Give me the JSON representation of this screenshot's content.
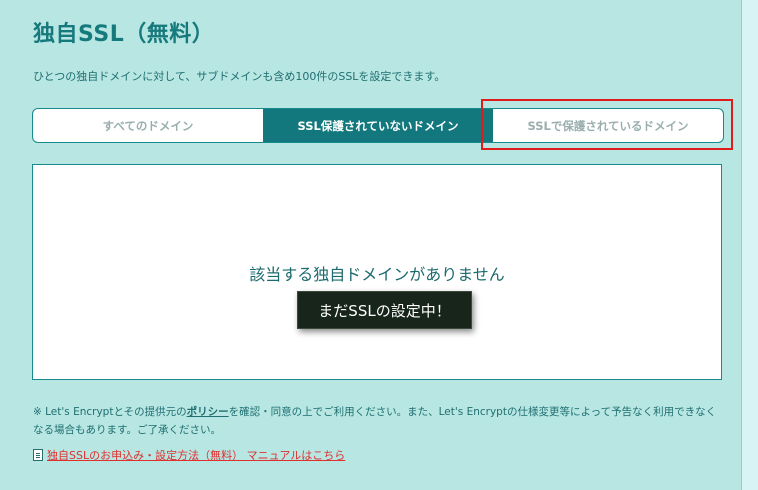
{
  "page": {
    "title": "独自SSL（無料）",
    "description": "ひとつの独自ドメインに対して、サブドメインも含め100件のSSLを設定できます。"
  },
  "tabs": [
    {
      "label": "すべてのドメイン",
      "active": false
    },
    {
      "label": "SSL保護されていないドメイン",
      "active": true
    },
    {
      "label": "SSLで保護されているドメイン",
      "active": false
    }
  ],
  "content": {
    "empty_message": "該当する独自ドメインがありません"
  },
  "toast": {
    "message": "まだSSLの設定中！"
  },
  "note": {
    "prefix": "※ Let's Encryptとその提供元の",
    "policy_link": "ポリシー",
    "suffix": "を確認・同意の上でご利用ください。また、Let's Encryptの仕様変更等によって予告なく利用できなくなる場合もあります。ご了承ください。"
  },
  "manual": {
    "icon": "document-icon",
    "link_text": "独自SSLのお申込み・設定方法（無料） マニュアルはこちら"
  },
  "colors": {
    "panel_bg": "#b7e6e3",
    "accent": "#13787e",
    "highlight": "#e01b1b",
    "link": "#e0302d"
  }
}
